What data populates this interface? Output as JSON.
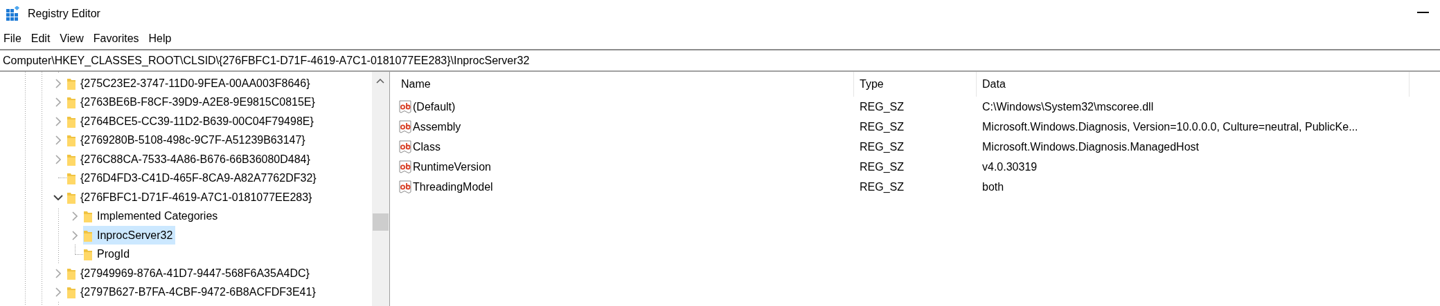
{
  "window": {
    "title": "Registry Editor"
  },
  "menu": [
    "File",
    "Edit",
    "View",
    "Favorites",
    "Help"
  ],
  "address": "Computer\\HKEY_CLASSES_ROOT\\CLSID\\{276FBFC1-D71F-4619-A7C1-0181077EE283}\\InprocServer32",
  "tree": {
    "items": [
      {
        "label": "{275C23E2-3747-11D0-9FEA-00AA003F8646}",
        "expandable": true,
        "expanded": false,
        "selected": false
      },
      {
        "label": "{2763BE6B-F8CF-39D9-A2E8-9E9815C0815E}",
        "expandable": true,
        "expanded": false,
        "selected": false
      },
      {
        "label": "{2764BCE5-CC39-11D2-B639-00C04F79498E}",
        "expandable": true,
        "expanded": false,
        "selected": false
      },
      {
        "label": "{2769280B-5108-498c-9C7F-A51239B63147}",
        "expandable": true,
        "expanded": false,
        "selected": false
      },
      {
        "label": "{276C88CA-7533-4A86-B676-66B36080D484}",
        "expandable": true,
        "expanded": false,
        "selected": false
      },
      {
        "label": "{276D4FD3-C41D-465F-8CA9-A82A7762DF32}",
        "expandable": false,
        "selected": false
      },
      {
        "label": "{276FBFC1-D71F-4619-A7C1-0181077EE283}",
        "expandable": true,
        "expanded": true,
        "selected": false,
        "children": [
          {
            "label": "Implemented Categories",
            "expandable": true,
            "expanded": false,
            "selected": false
          },
          {
            "label": "InprocServer32",
            "expandable": true,
            "expanded": false,
            "selected": true
          },
          {
            "label": "ProgId",
            "expandable": false,
            "selected": false
          }
        ]
      },
      {
        "label": "{27949969-876A-41D7-9447-568F6A35A4DC}",
        "expandable": true,
        "expanded": false,
        "selected": false
      },
      {
        "label": "{2797B627-B7FA-4CBF-9472-6B8ACFDF3E41}",
        "expandable": true,
        "expanded": false,
        "selected": false
      }
    ]
  },
  "values": {
    "columns": [
      "Name",
      "Type",
      "Data"
    ],
    "rows": [
      {
        "name": "(Default)",
        "type": "REG_SZ",
        "data": "C:\\Windows\\System32\\mscoree.dll"
      },
      {
        "name": "Assembly",
        "type": "REG_SZ",
        "data": "Microsoft.Windows.Diagnosis, Version=10.0.0.0, Culture=neutral, PublicKe..."
      },
      {
        "name": "Class",
        "type": "REG_SZ",
        "data": "Microsoft.Windows.Diagnosis.ManagedHost"
      },
      {
        "name": "RuntimeVersion",
        "type": "REG_SZ",
        "data": "v4.0.30319"
      },
      {
        "name": "ThreadingModel",
        "type": "REG_SZ",
        "data": "both"
      }
    ]
  }
}
